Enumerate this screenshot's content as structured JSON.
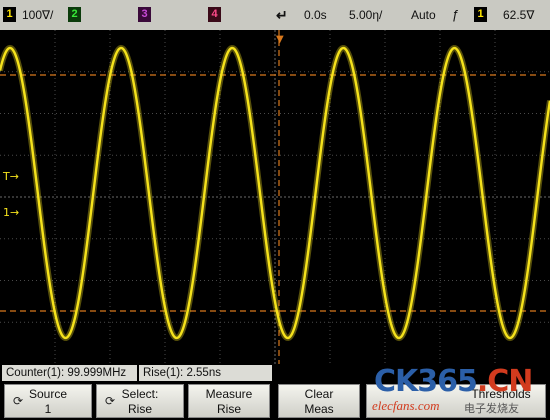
{
  "status_bar": {
    "ch1": {
      "number": "1",
      "scale": "100∇/"
    },
    "ch2": {
      "number": "2"
    },
    "ch3": {
      "number": "3"
    },
    "ch4": {
      "number": "4"
    },
    "time_delay": "0.0s",
    "time_scale": "5.00η/",
    "trigger_mode": "Auto",
    "trigger_slope_icon": "rising-edge-icon",
    "trigger_source": "1",
    "trigger_level": "62.5∇"
  },
  "colors": {
    "trace": "#f5e21c",
    "grid": "#4a4a4a",
    "cursor": "#d8781c",
    "status_bg": "#c9c9c2"
  },
  "waveform": {
    "type": "sine",
    "cycles_visible": 5,
    "marker_icons": [
      "trigger-level-icon",
      "ground-level-icon",
      "trigger-position-icon"
    ]
  },
  "readouts": {
    "counter": "Counter(1): 99.999MHz",
    "rise": "Rise(1): 2.55ns"
  },
  "softkeys": [
    {
      "line1": "Source",
      "line2": "1",
      "icon": "rotary-knob-icon"
    },
    {
      "line1": "Select:",
      "line2": "Rise",
      "icon": "rotary-knob-icon"
    },
    {
      "line1": "Measure",
      "line2": "Rise"
    },
    {
      "line1": "Clear",
      "line2": "Meas"
    },
    {
      "line1": "Thresholds",
      "line2": ""
    }
  ],
  "watermark": {
    "brand": "CK365",
    "brand_suffix": ".CN",
    "site": "elecfans.com",
    "tagline": "电子发烧友"
  }
}
